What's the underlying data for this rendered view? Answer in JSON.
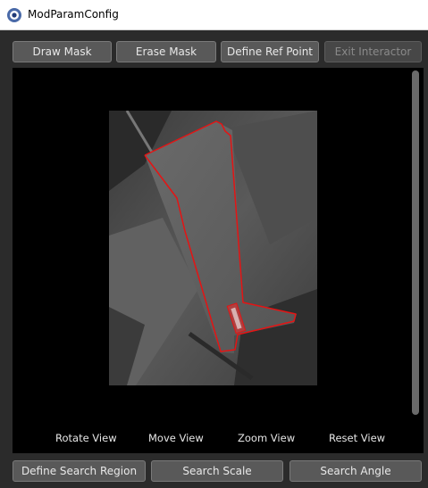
{
  "window": {
    "title": "ModParamConfig"
  },
  "toolbar": {
    "draw_mask": "Draw Mask",
    "erase_mask": "Erase Mask",
    "define_ref_point": "Define Ref Point",
    "exit_interactor": "Exit Interactor"
  },
  "view_controls": {
    "rotate": "Rotate View",
    "move": "Move View",
    "zoom": "Zoom View",
    "reset": "Reset View"
  },
  "bottom_bar": {
    "define_search_region": "Define Search Region",
    "search_scale": "Search Scale",
    "search_angle": "Search Angle"
  },
  "colors": {
    "mask_outline": "#e41414",
    "button_bg": "#595959",
    "window_bg": "#2b2b2b"
  }
}
